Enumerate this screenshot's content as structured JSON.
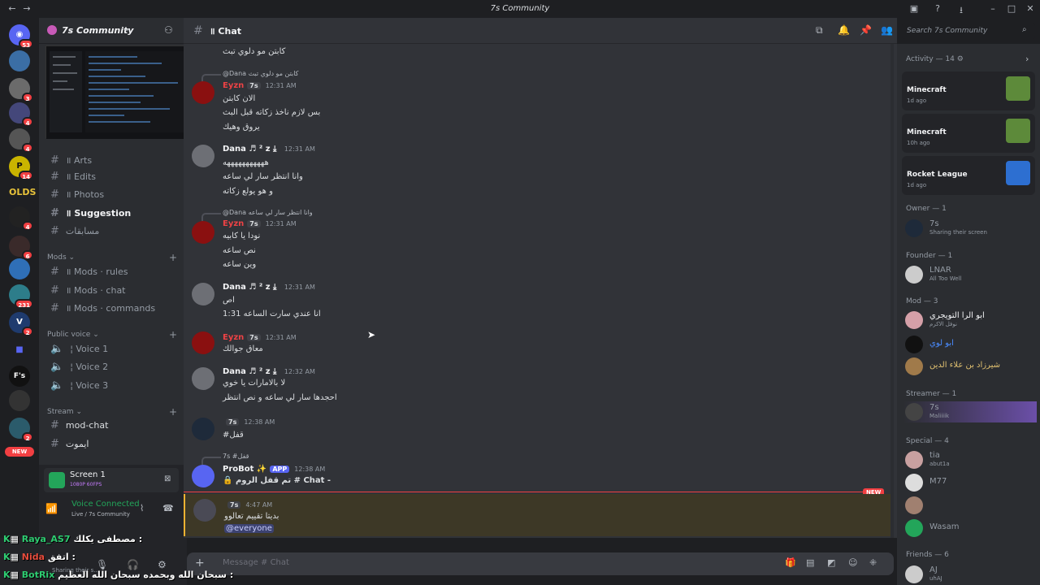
{
  "window": {
    "title": "7s Community"
  },
  "server": {
    "name": "7s Community"
  },
  "guild_badges": [
    "53",
    "3",
    "4",
    "4",
    "14",
    "4",
    "6",
    "231",
    "2",
    "2"
  ],
  "guild_label_olds": "OLDS",
  "guild_label_fs": "F's",
  "guild_new": "NEW",
  "channels": {
    "items": [
      {
        "name": "Arts",
        "bold": false
      },
      {
        "name": "Edits",
        "bold": false
      },
      {
        "name": "Photos",
        "bold": false
      },
      {
        "name": "Suggestion",
        "bold": true
      },
      {
        "name": "مسابقات",
        "bold": false
      }
    ],
    "cat_mods": "Mods",
    "mods": [
      "Mods · rules",
      "Mods · chat",
      "Mods · commands"
    ],
    "cat_voice": "Public voice",
    "voice": [
      "Voice 1",
      "Voice 2",
      "Voice 3"
    ],
    "cat_stream": "Stream",
    "stream": [
      "mod-chat",
      "ايموت"
    ]
  },
  "screen_share": {
    "title": "Screen 1",
    "quality": "1080P 60FPS"
  },
  "voice_status": {
    "title": "Voice Connected",
    "sub": "Live / 7s Community"
  },
  "chat": {
    "channel": "Chat",
    "search_placeholder": "Search 7s Community",
    "messages": [
      {
        "kind": "line",
        "text": "كابتن مو دلوي تبث"
      },
      {
        "kind": "reply",
        "text": "@Dana كابتن مو دلوي تبث"
      },
      {
        "kind": "head",
        "name": "Eyzn",
        "tag": "7s",
        "time": "12:31 AM",
        "lines": [
          "الان كابتن",
          "بس لازم ناخذ زكاته قبل البث",
          "يروق وهيك"
        ]
      },
      {
        "kind": "head",
        "name": "Dana",
        "tag": "",
        "time": "12:31 AM",
        "lines": [
          "هههههههههههه",
          "وانا انتظر سار لي ساعه",
          "و هو يولع زكاته"
        ]
      },
      {
        "kind": "reply",
        "text": "@Dana وانا انتظر سار لي ساعه"
      },
      {
        "kind": "head",
        "name": "Eyzn",
        "tag": "7s",
        "time": "12:31 AM",
        "lines": [
          "نودا يا كابيه",
          "نص ساعه",
          "وين ساعه"
        ]
      },
      {
        "kind": "head",
        "name": "Dana",
        "tag": "",
        "time": "12:31 AM",
        "lines": [
          "اص",
          "انا عندي سارت الساعه 1:31"
        ]
      },
      {
        "kind": "head",
        "name": "Eyzn",
        "tag": "7s",
        "time": "12:31 AM",
        "lines": [
          "معاق جوالك"
        ]
      },
      {
        "kind": "head",
        "name": "Dana",
        "tag": "",
        "time": "12:32 AM",
        "lines": [
          "لا بالامارات يا خوي",
          "احجدها سار لي ساعه و نص انتظر"
        ]
      },
      {
        "kind": "head",
        "name": "",
        "tag": "7s",
        "time": "12:38 AM",
        "lines": [
          "#قفل"
        ]
      },
      {
        "kind": "reply",
        "text": "7s #قفل"
      },
      {
        "kind": "head",
        "name": "ProBot ✨",
        "tag": "APP",
        "time": "12:38 AM",
        "lines": [
          "🔒 تم قفل الروم # Chat -"
        ]
      },
      {
        "kind": "head",
        "name": "",
        "tag": "7s",
        "time": "4:47 AM",
        "lines": [
          "بديتا تقييم تعالوو",
          "@everyone"
        ]
      }
    ],
    "new_label": "NEW",
    "composer_placeholder": "Message # Chat"
  },
  "members": {
    "activity_title": "Activity — 14",
    "activities": [
      {
        "game": "Minecraft",
        "time": "1d ago",
        "color": "#5d8a3a"
      },
      {
        "game": "Minecraft",
        "time": "10h ago",
        "color": "#5d8a3a"
      },
      {
        "game": "Rocket League",
        "time": "1d ago",
        "color": "#2d6fd1"
      }
    ],
    "groups": [
      {
        "title": "Owner — 1",
        "members": [
          {
            "name": "7s",
            "sub": "Sharing their screen",
            "color": "#949ba4"
          }
        ]
      },
      {
        "title": "Founder — 1",
        "members": [
          {
            "name": "LNAR",
            "sub": "All Too Well",
            "color": "#949ba4"
          }
        ]
      },
      {
        "title": "Mod — 3",
        "members": [
          {
            "name": "ابو الرا التويجري",
            "sub": "نوفل الاكرم",
            "color": "#f2f3f5"
          },
          {
            "name": "ابو لوي",
            "sub": "",
            "color": "#4a8cff"
          },
          {
            "name": "شيرزاد بن علاء الدين",
            "sub": "",
            "color": "#e0c070"
          }
        ]
      },
      {
        "title": "Streamer — 1",
        "members": [
          {
            "name": "7s",
            "sub": "Maliiiik",
            "color": "#949ba4"
          }
        ]
      },
      {
        "title": "Special — 4",
        "members": [
          {
            "name": "tia",
            "sub": "abut1a",
            "color": "#949ba4"
          },
          {
            "name": "M77",
            "sub": "",
            "color": "#949ba4"
          },
          {
            "name": "",
            "sub": "",
            "color": "#949ba4"
          },
          {
            "name": "Wasam",
            "sub": "",
            "color": "#949ba4"
          }
        ]
      },
      {
        "title": "Friends — 6",
        "members": [
          {
            "name": "AJ",
            "sub": "uhAJ",
            "color": "#949ba4"
          }
        ]
      }
    ]
  },
  "overlay": [
    {
      "name": "Raya_AS7",
      "text": "مصطفى يكلك :",
      "color": "#2ecc71"
    },
    {
      "name": "Nida",
      "text": "اتفق :",
      "color": "#e74c3c"
    },
    {
      "name": "BotRix",
      "text": "سبحان الله وبحمده سبحان الله العظيم :",
      "color": "#2ecc71"
    }
  ],
  "status_text": "Sharing their s..."
}
